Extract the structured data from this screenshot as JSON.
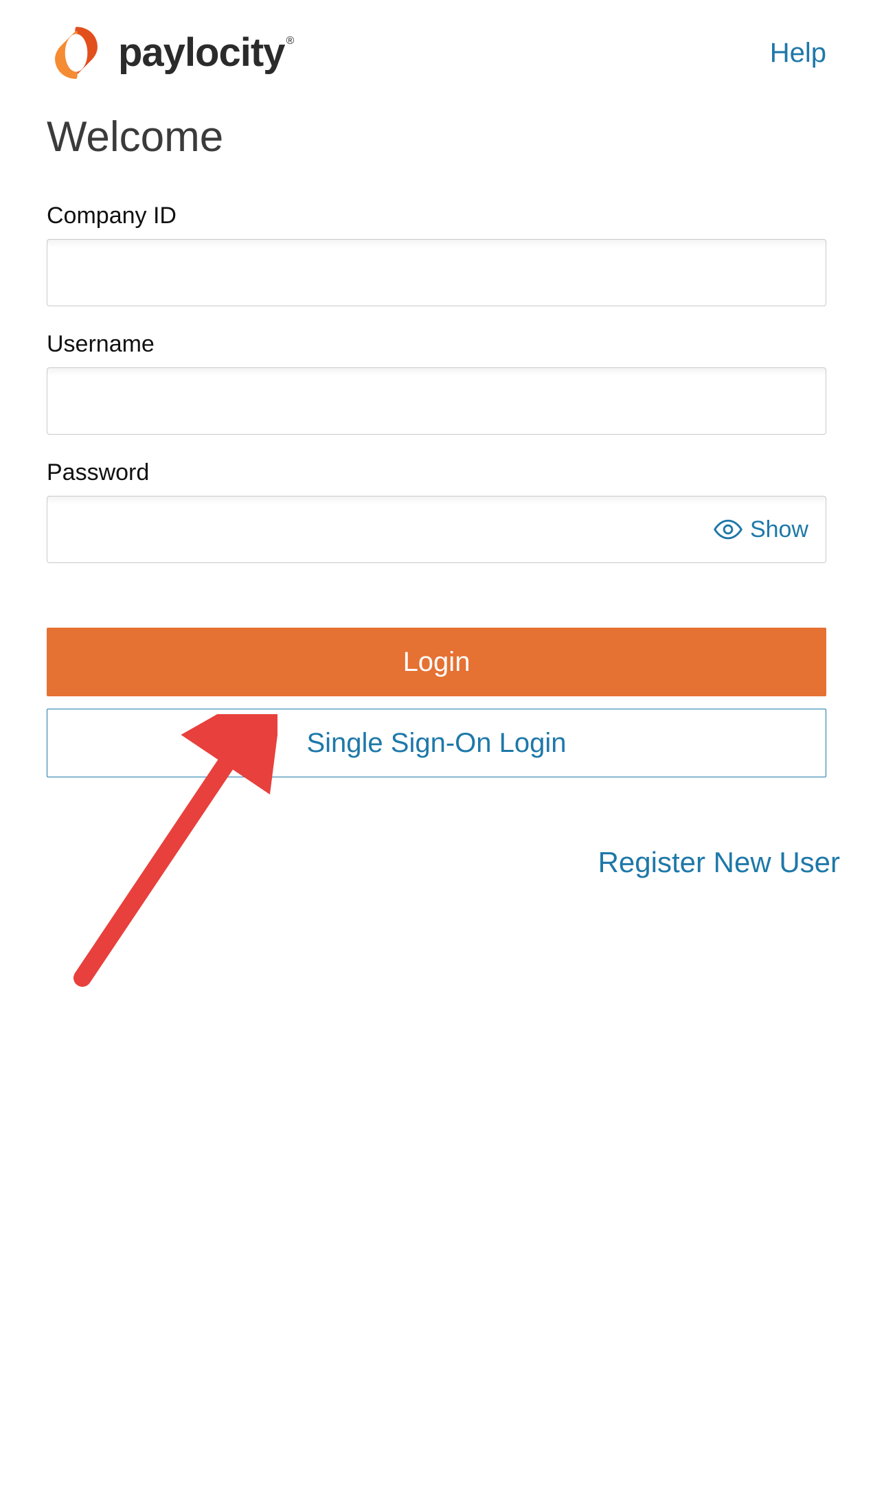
{
  "brand": {
    "name": "paylocity"
  },
  "header": {
    "help_label": "Help"
  },
  "page": {
    "title": "Welcome"
  },
  "form": {
    "company_id": {
      "label": "Company ID",
      "value": ""
    },
    "username": {
      "label": "Username",
      "value": ""
    },
    "password": {
      "label": "Password",
      "value": "",
      "show_toggle_label": "Show"
    },
    "login_button_label": "Login",
    "sso_button_label": "Single Sign-On Login"
  },
  "links": {
    "register_label": "Register New User"
  },
  "annotation": {
    "arrow_target": "sso-button"
  }
}
